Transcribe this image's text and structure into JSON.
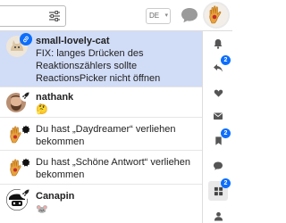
{
  "header": {
    "language": "DE",
    "icons": [
      "filter-icon",
      "chat-icon",
      "user-avatar"
    ]
  },
  "notifications": [
    {
      "user": "small-lovely-cat",
      "text": "FIX: langes Drücken des Reaktionszählers sollte ReactionsPicker nicht öffnen",
      "lines": [
        "FIX: langes Drücken des",
        "Reaktionszählers sollte",
        "ReactionsPicker nicht öffnen"
      ],
      "badge_icon": "link-icon",
      "highlighted": true
    },
    {
      "user": "nathank",
      "secondary": "🤔",
      "badge_icon": "rocket-icon"
    },
    {
      "text_lines": [
        "Du hast „Daydreamer“ verliehen",
        "bekommen"
      ],
      "badge_icon": "badge-icon"
    },
    {
      "text_lines": [
        "Du hast „Schöne Antwort“ verliehen",
        "bekommen"
      ],
      "badge_icon": "badge-icon"
    },
    {
      "user": "Canapin",
      "secondary": "🐭",
      "badge_icon": "rocket-icon"
    }
  ],
  "rail": {
    "items": [
      {
        "icon": "bell-icon",
        "count": null
      },
      {
        "icon": "reply-icon",
        "count": "2"
      },
      {
        "icon": "heart-icon",
        "count": null
      },
      {
        "icon": "mail-icon",
        "count": null
      },
      {
        "icon": "bookmark-icon",
        "count": "2"
      },
      {
        "icon": "chat-icon",
        "count": null
      },
      {
        "icon": "review-icon",
        "count": "2"
      },
      {
        "icon": "person-icon",
        "count": null
      }
    ]
  },
  "colors": {
    "highlight": "#d1dcf7",
    "accent": "#0d6efd",
    "rail_active": "#e9e9e9"
  }
}
